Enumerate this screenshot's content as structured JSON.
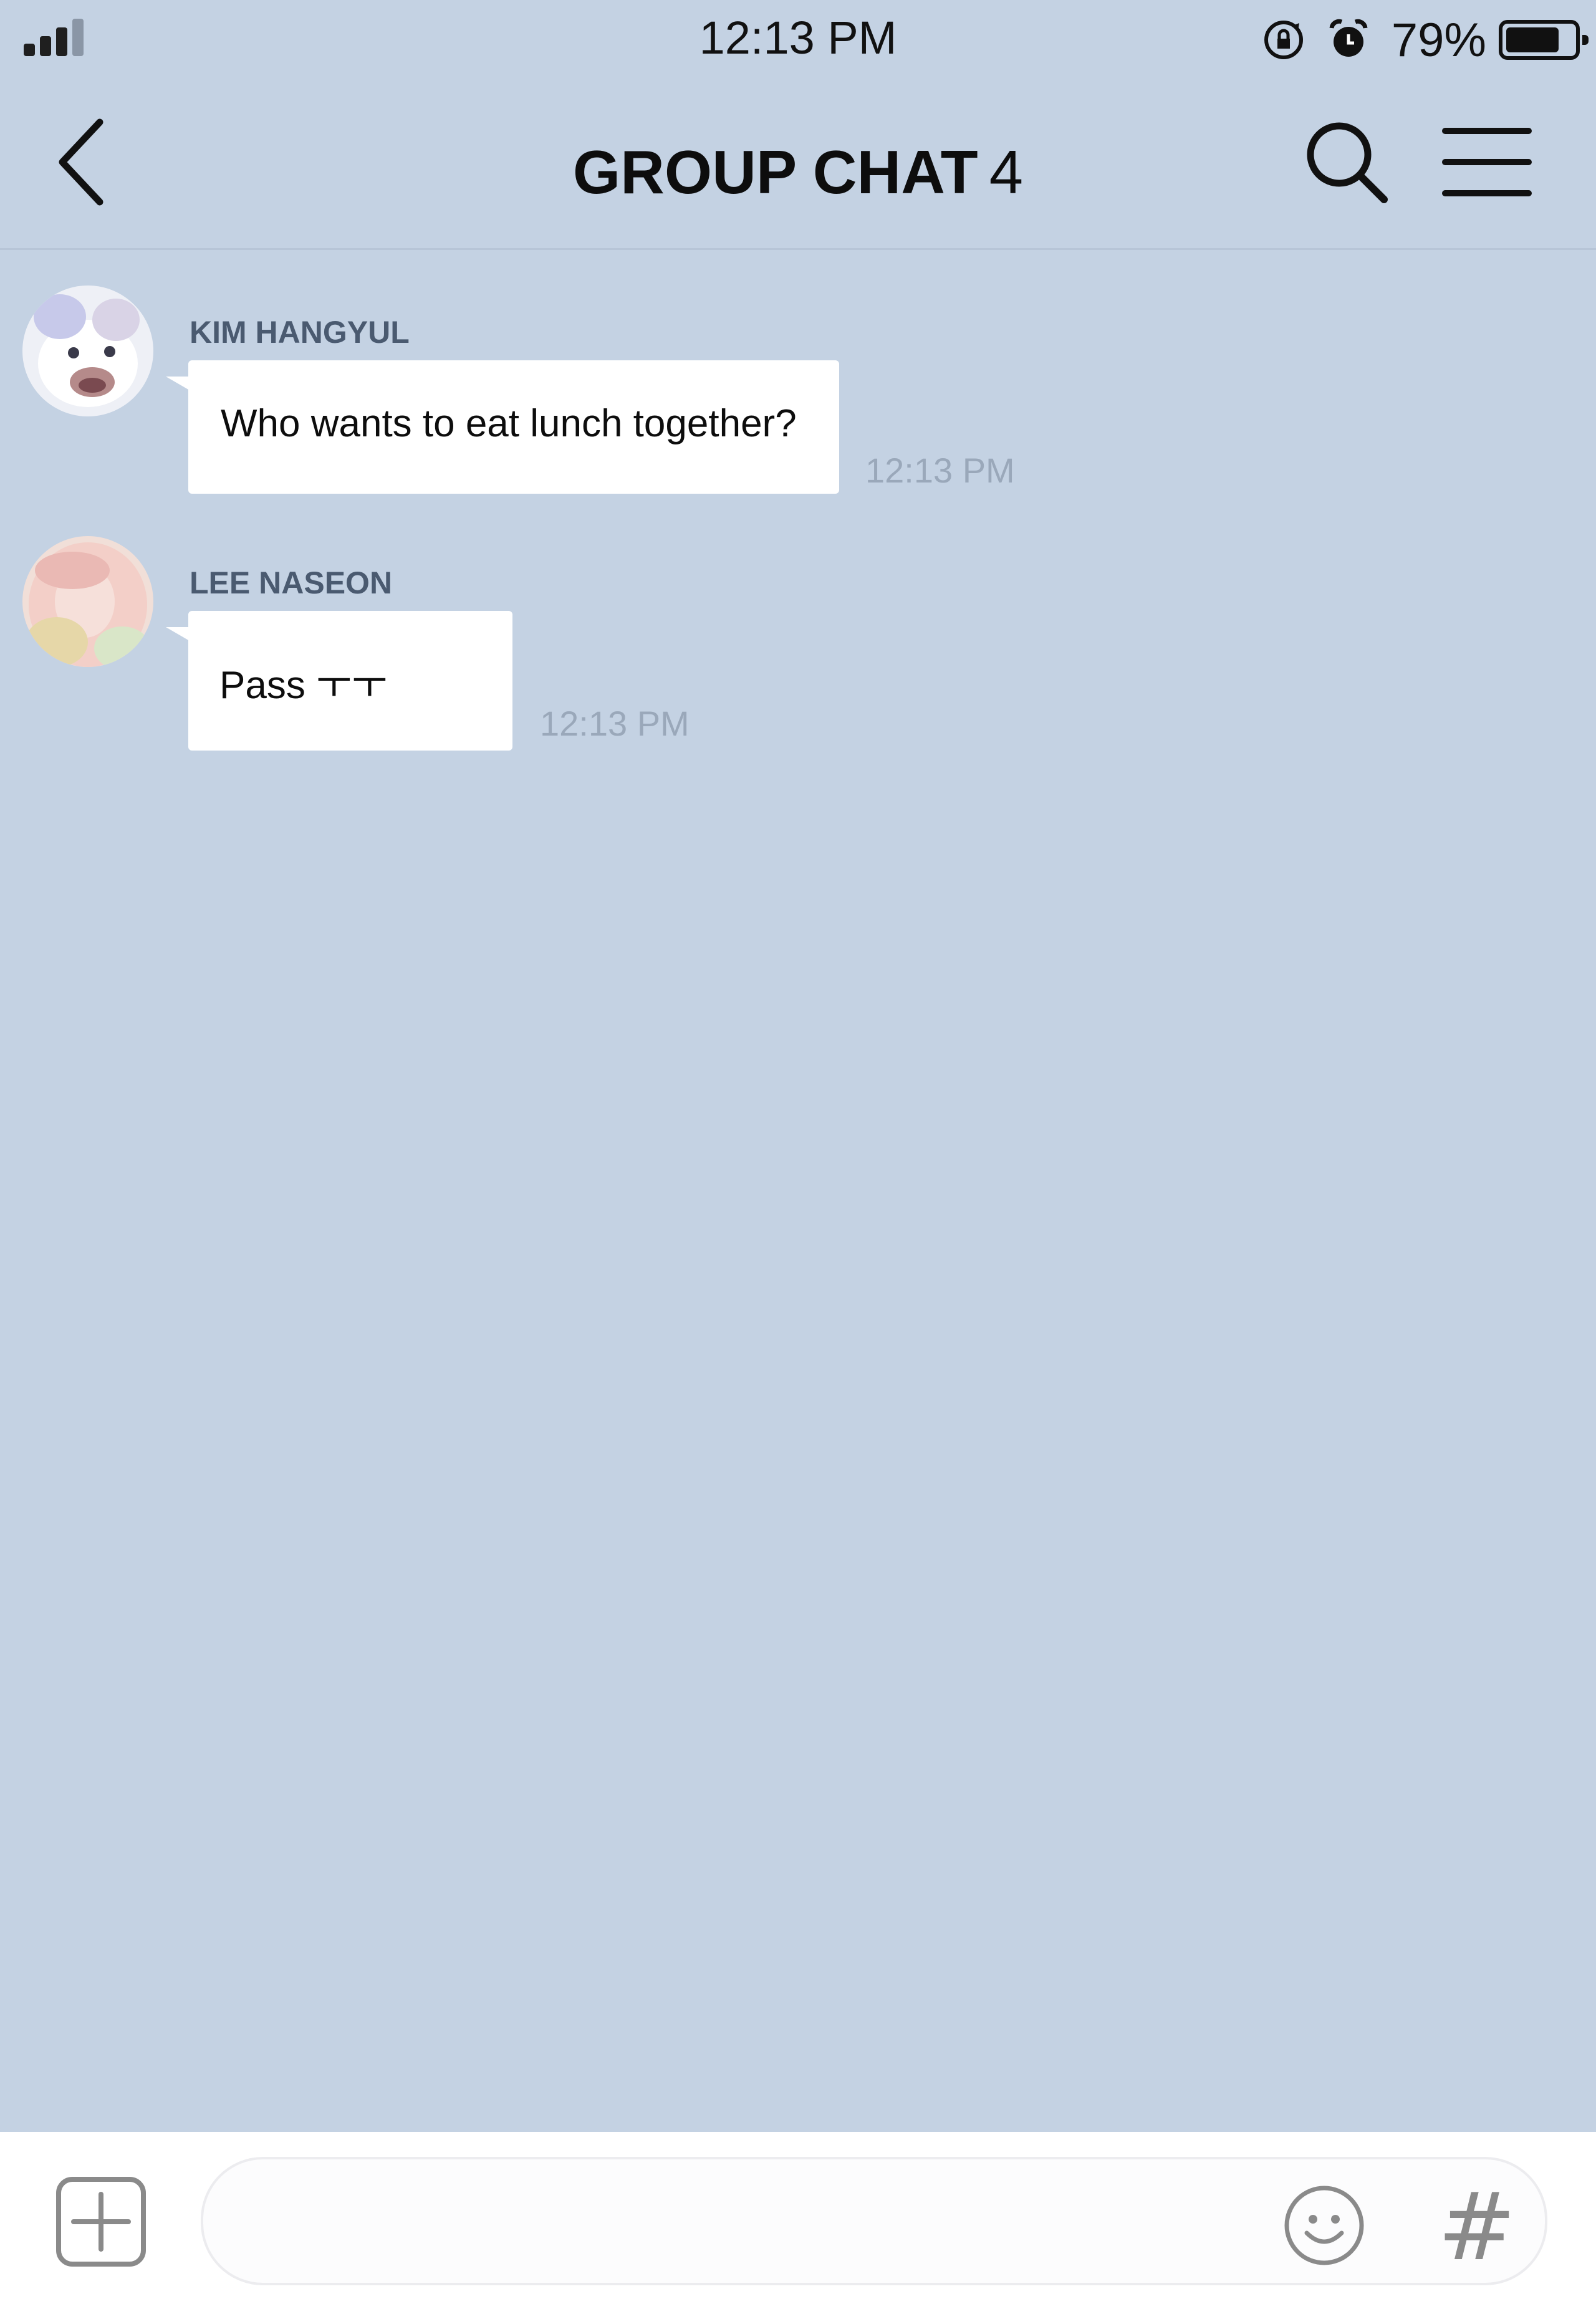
{
  "status_bar": {
    "time": "12:13 PM",
    "battery_percent": "79%",
    "battery_level": 0.79,
    "signal_bars_filled": 3,
    "signal_bars_total": 4,
    "icons": [
      "signal-icon",
      "rotation-lock-icon",
      "alarm-icon",
      "battery-icon"
    ]
  },
  "header": {
    "title": "GROUP CHAT",
    "member_count": "4",
    "icons": [
      "back-chevron-icon",
      "search-icon",
      "menu-icon"
    ]
  },
  "messages": [
    {
      "sender": "KIM HANGYUL",
      "text": "Who wants to eat lunch together?",
      "time": "12:13 PM",
      "avatar": "avatar-kim-hangyul"
    },
    {
      "sender": "LEE NASEON",
      "text": "Pass ㅜㅜ",
      "time": "12:13 PM",
      "avatar": "avatar-lee-naseon"
    }
  ],
  "input_bar": {
    "placeholder": "",
    "icons": [
      "plus-icon",
      "emoji-icon",
      "hashtag-icon"
    ],
    "hashtag_glyph": "#"
  },
  "colors": {
    "background": "#c4d2e3",
    "bubble": "#ffffff",
    "sender_name": "#4a5a70",
    "timestamp": "#9aa8ba"
  }
}
